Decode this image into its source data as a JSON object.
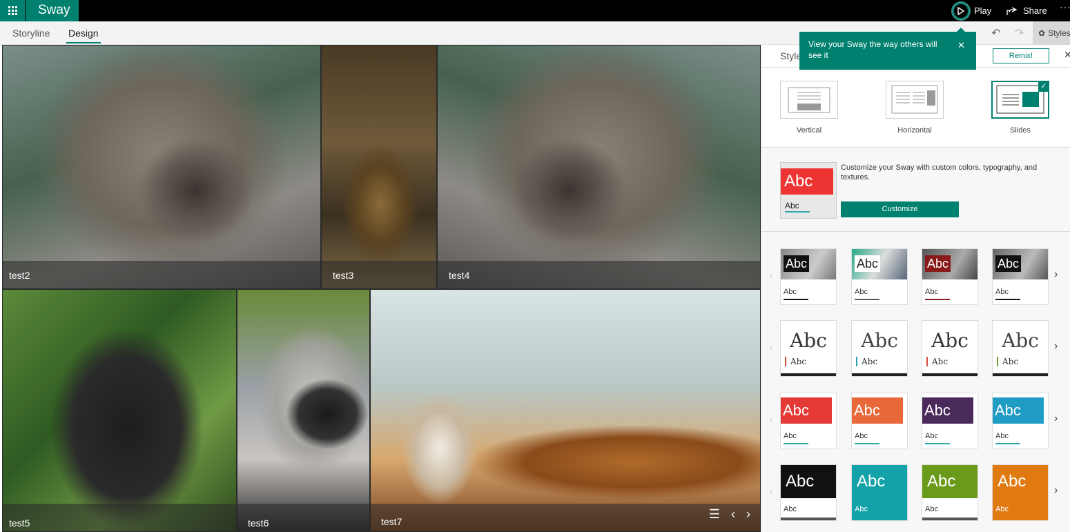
{
  "app": {
    "name": "Sway"
  },
  "topbar": {
    "play_label": "Play",
    "share_label": "Share",
    "more_label": "···"
  },
  "tabs": [
    {
      "label": "Storyline"
    },
    {
      "label": "Design"
    }
  ],
  "toolbar": {
    "style_label": "Styles"
  },
  "tooltip": {
    "text": "View your Sway the way others will see it"
  },
  "canvas": {
    "tiles": [
      {
        "caption": "test2"
      },
      {
        "caption": "test3"
      },
      {
        "caption": "test4"
      },
      {
        "caption": "test5"
      },
      {
        "caption": "test6"
      },
      {
        "caption": "test7"
      }
    ]
  },
  "panel": {
    "title": "Styles",
    "remix_label": "Remix!",
    "layouts": [
      {
        "label": "Vertical"
      },
      {
        "label": "Horizontal"
      },
      {
        "label": "Slides",
        "selected": true
      }
    ],
    "customize": {
      "thumb_heading": "Abc",
      "thumb_sub": "Abc",
      "description": "Customize your Sway with custom colors, typography, and textures.",
      "button_label": "Customize"
    },
    "style_rows": [
      {
        "cards": [
          {
            "heading": "Abc",
            "sub": "Abc",
            "accent": "#111111"
          },
          {
            "heading": "Abc",
            "sub": "Abc",
            "accent": "#ffffff"
          },
          {
            "heading": "Abc",
            "sub": "Abc",
            "accent": "#8a1a1a"
          },
          {
            "heading": "Abc",
            "sub": "Abc",
            "accent": "#111111"
          }
        ]
      },
      {
        "cards": [
          {
            "heading": "Abc",
            "sub": "Abc",
            "accent": "#c0502a"
          },
          {
            "heading": "Abc",
            "sub": "Abc",
            "accent": "#2aa0b0"
          },
          {
            "heading": "Abc",
            "sub": "Abc",
            "accent": "#d04a3a"
          },
          {
            "heading": "Abc",
            "sub": "Abc",
            "accent": "#6aa02a"
          }
        ]
      },
      {
        "cards": [
          {
            "heading": "Abc",
            "sub": "Abc",
            "accent": "#e53935"
          },
          {
            "heading": "Abc",
            "sub": "Abc",
            "accent": "#e8683a"
          },
          {
            "heading": "Abc",
            "sub": "Abc",
            "accent": "#4a2a5a"
          },
          {
            "heading": "Abc",
            "sub": "Abc",
            "accent": "#1e9cc4"
          }
        ]
      },
      {
        "cards": [
          {
            "heading": "Abc",
            "sub": "Abc",
            "accent": "#111111"
          },
          {
            "heading": "Abc",
            "sub": "Abc",
            "accent": "#12a2a8"
          },
          {
            "heading": "Abc",
            "sub": "Abc",
            "accent": "#6a9a1a"
          },
          {
            "heading": "Abc",
            "sub": "Abc",
            "accent": "#e07a10"
          }
        ]
      }
    ]
  },
  "colors": {
    "brand": "#00806f"
  }
}
